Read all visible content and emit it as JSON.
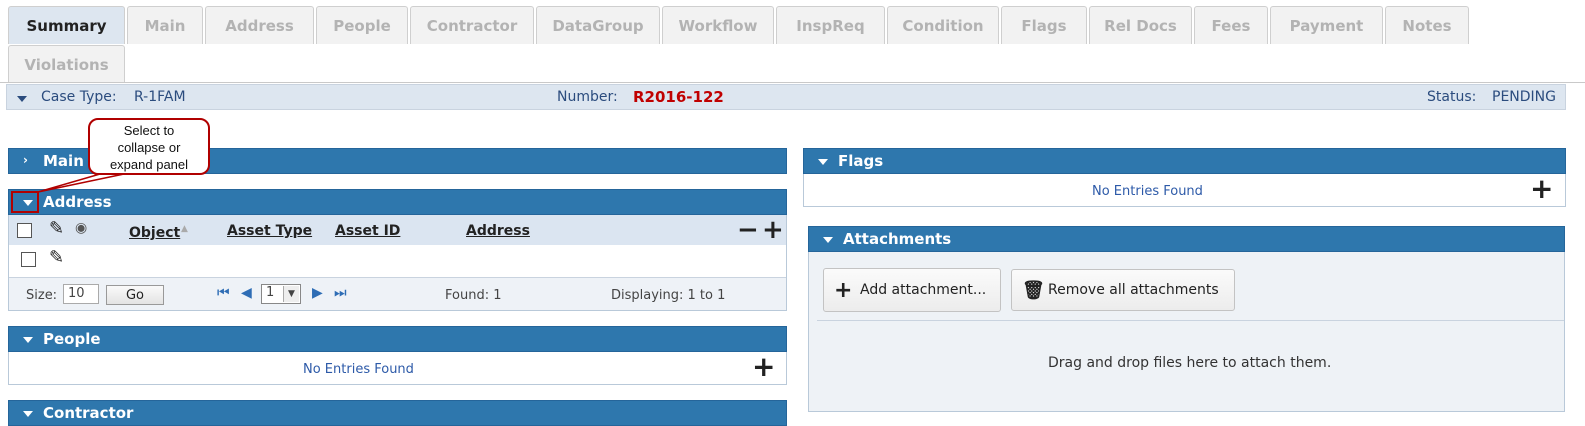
{
  "tabs": [
    {
      "label": "Summary",
      "active": true
    },
    {
      "label": "Main"
    },
    {
      "label": "Address"
    },
    {
      "label": "People"
    },
    {
      "label": "Contractor"
    },
    {
      "label": "DataGroup"
    },
    {
      "label": "Workflow"
    },
    {
      "label": "InspReq"
    },
    {
      "label": "Condition"
    },
    {
      "label": "Flags"
    },
    {
      "label": "Rel Docs"
    },
    {
      "label": "Fees"
    },
    {
      "label": "Payment"
    },
    {
      "label": "Notes"
    },
    {
      "label": "Violations"
    }
  ],
  "status_bar": {
    "case_type_label": "Case Type:",
    "case_type_value": "R-1FAM",
    "number_label": "Number:",
    "number_value": "R2016-122",
    "status_label": "Status:",
    "status_value": "PENDING"
  },
  "callout": {
    "line1": "Select to",
    "line2": "collapse or",
    "line3": "expand panel"
  },
  "panels": {
    "main": {
      "title": "Main"
    },
    "address": {
      "title": "Address",
      "columns": [
        "Object",
        "Asset Type",
        "Asset ID",
        "Address"
      ],
      "footer": {
        "size_label": "Size:",
        "size_value": "10",
        "go_label": "Go",
        "page_value": "1",
        "found": "Found: 1",
        "displaying": "Displaying: 1 to 1"
      }
    },
    "people": {
      "title": "People",
      "empty": "No Entries Found"
    },
    "contractor": {
      "title": "Contractor"
    },
    "flags": {
      "title": "Flags",
      "empty": "No Entries Found"
    },
    "attachments": {
      "title": "Attachments",
      "add_label": "Add attachment...",
      "remove_label": "Remove all attachments",
      "drop_text": "Drag and drop files here to attach them."
    }
  },
  "icons": {
    "collapse": "chevron-down-icon",
    "expand": "chevron-right-icon",
    "add": "plus-icon",
    "remove": "minus-icon",
    "edit": "edit-icon",
    "view": "eye-icon",
    "trash": "trash-icon"
  },
  "colors": {
    "panel_header": "#2e77ad",
    "status_bar": "#dde6f0",
    "number": "#c00000",
    "callout_border": "#b00000",
    "link_text": "#2d5aa8"
  }
}
